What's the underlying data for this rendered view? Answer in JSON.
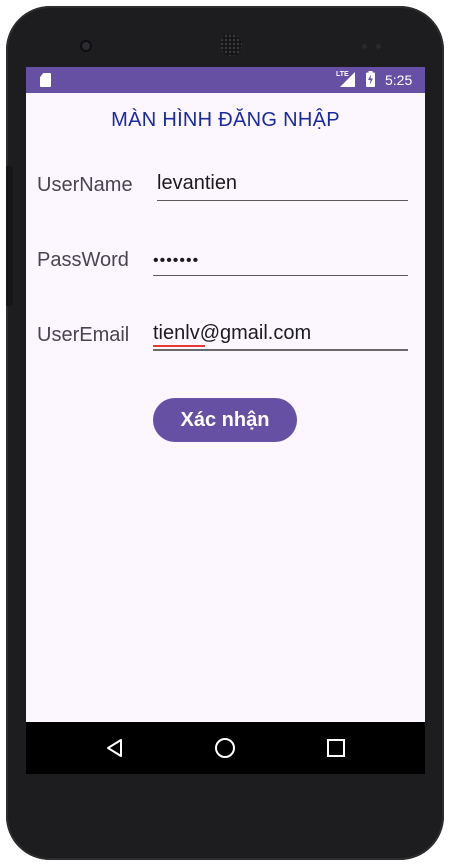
{
  "status_bar": {
    "network": "LTE",
    "time": "5:25"
  },
  "screen": {
    "title": "MÀN HÌNH ĐĂNG NHẬP",
    "username": {
      "label": "UserName",
      "value": "levantien"
    },
    "password": {
      "label": "PassWord",
      "value": "•••••••"
    },
    "email": {
      "label": "UserEmail",
      "value": "tienlv@gmail.com"
    },
    "confirm_label": "Xác nhận"
  },
  "nav_bar": {
    "icons": [
      "back-icon",
      "home-icon",
      "recents-icon"
    ]
  },
  "colors": {
    "accent": "#6650a4",
    "title": "#1a2aa0",
    "background": "#fcf6ff"
  }
}
